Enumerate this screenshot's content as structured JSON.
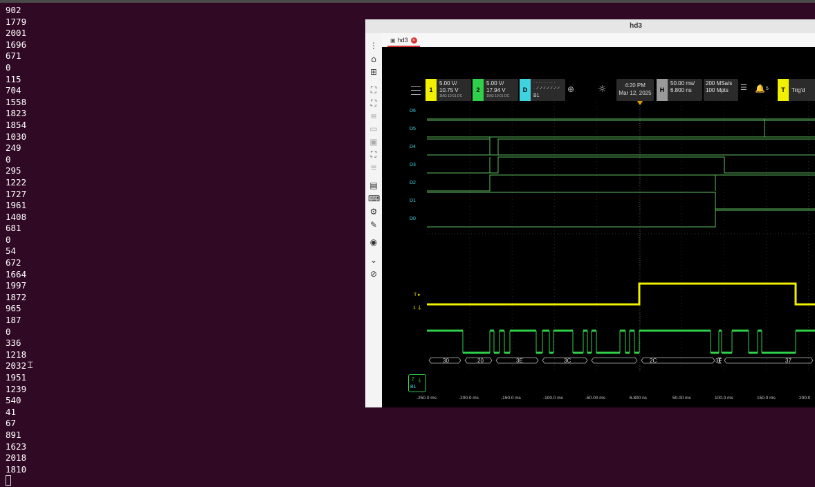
{
  "terminal": {
    "lines": [
      "902",
      "1779",
      "2001",
      "1696",
      "671",
      "0",
      "115",
      "704",
      "1558",
      "1823",
      "1854",
      "1030",
      "249",
      "0",
      "295",
      "1222",
      "1727",
      "1961",
      "1408",
      "681",
      "0",
      "54",
      "672",
      "1664",
      "1997",
      "1872",
      "965",
      "187",
      "0",
      "336",
      "1218",
      "2032",
      "1951",
      "1239",
      "540",
      "41",
      "67",
      "891",
      "1623",
      "2018",
      "1810"
    ]
  },
  "window": {
    "title": "hd3",
    "tab_label": "hd3"
  },
  "toolrail_icons": [
    "more-icon",
    "home-icon",
    "add-window-icon",
    "fit-screen-icon",
    "fullscreen-icon",
    "list-icon",
    "screen-dim-icon",
    "screen-dim2-icon",
    "zoom-screen-icon",
    "lines-icon",
    "window-icon",
    "keyboard-icon",
    "settings-gear-icon",
    "wrench-icon",
    "camera-icon",
    "chevron-down-icon",
    "link-icon"
  ],
  "scope": {
    "ch1": {
      "tag": "1",
      "scale": "5.00 V/",
      "offset": "10.75 V",
      "sub": "1MΩ  10:01  DC",
      "color": "#f0f000"
    },
    "ch2": {
      "tag": "2",
      "scale": "5.00 V/",
      "offset": "17.94 V",
      "sub": "1MΩ  10:01  DC",
      "color": "#2fd14a"
    },
    "digital": {
      "tag": "D",
      "dots": "· · · · · · · · ·",
      "ticks": "· ✓✓✓✓✓✓✓",
      "bus": "B1",
      "color": "#3fd3e0"
    },
    "datetime": {
      "time": "4:20 PM",
      "date": "Mar 12, 2025"
    },
    "horizontal": {
      "tag": "H",
      "scale": "50.00 ms/",
      "delay": "6.800 ns"
    },
    "acq": {
      "rate": "200 MSa/s",
      "points": "100 Mpts"
    },
    "alert_count": "5",
    "trigger": {
      "tag": "T",
      "status": "Trig'd"
    },
    "digital_labels": [
      "D6",
      "D5",
      "D4",
      "D3",
      "D2",
      "D1",
      "D0"
    ],
    "trigger_marker": "T",
    "ch1_marker": "1",
    "ch2_chip": {
      "num": "2",
      "bus": "B1"
    },
    "decode": [
      "30",
      "20",
      "3E",
      "3C",
      "2C",
      "3F",
      "37"
    ],
    "time_ticks": [
      "-250.0 ms",
      "-200.0 ms",
      "-150.0 ms",
      "-100.0 ms",
      "-50.00 ms",
      "6.800 ns",
      "50.00 ms",
      "100.0 ms",
      "150.0 ms",
      "200.0"
    ]
  }
}
